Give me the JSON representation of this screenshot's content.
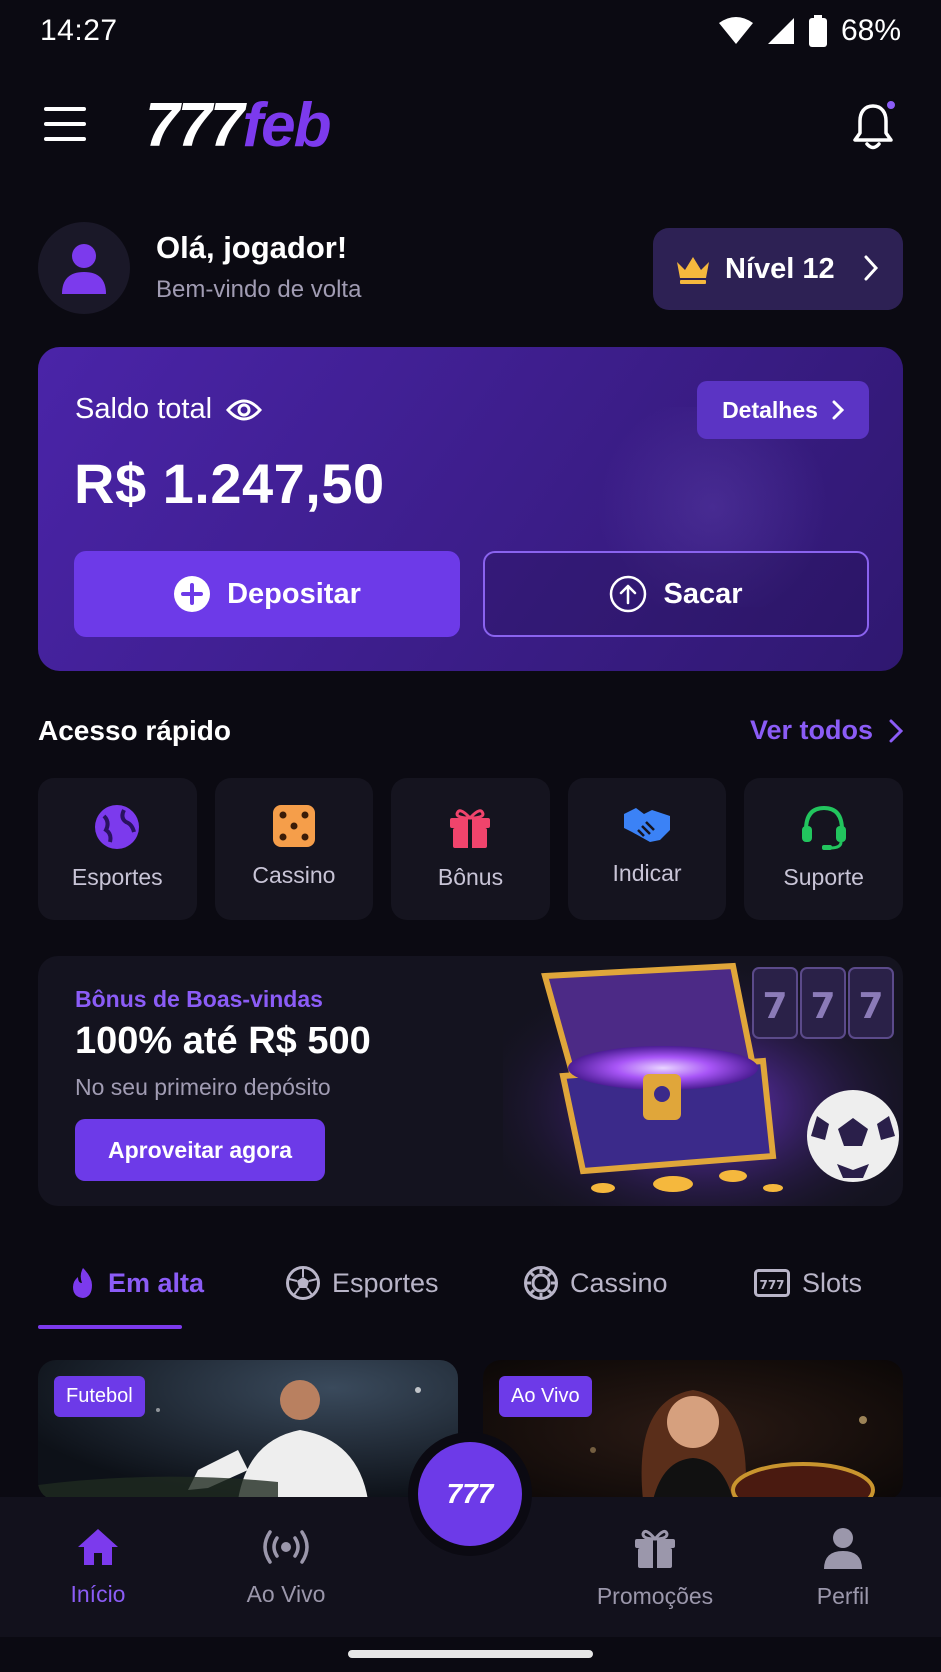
{
  "status_bar": {
    "time": "14:27",
    "battery": "68%"
  },
  "header": {
    "logo_part1": "777",
    "logo_part2": "feb"
  },
  "greeting": {
    "title": "Olá, jogador!",
    "subtitle": "Bem-vindo de volta",
    "level": "Nível 12"
  },
  "balance": {
    "label": "Saldo total",
    "details_label": "Detalhes",
    "value": "R$ 1.247,50",
    "deposit_label": "Depositar",
    "withdraw_label": "Sacar"
  },
  "quick_access": {
    "title": "Acesso rápido",
    "see_all": "Ver todos",
    "items": [
      {
        "label": "Esportes",
        "icon": "globe-icon"
      },
      {
        "label": "Cassino",
        "icon": "dice-icon"
      },
      {
        "label": "Bônus",
        "icon": "gift-icon"
      },
      {
        "label": "Indicar",
        "icon": "handshake-icon"
      },
      {
        "label": "Suporte",
        "icon": "headset-icon"
      }
    ]
  },
  "promo": {
    "kicker": "Bônus de Boas-vindas",
    "title": "100% até R$ 500",
    "subtitle": "No seu primeiro depósito",
    "cta": "Aproveitar agora"
  },
  "tabs": [
    {
      "label": "Em alta",
      "icon": "fire-icon",
      "active": true
    },
    {
      "label": "Esportes",
      "icon": "soccer-ball-icon"
    },
    {
      "label": "Cassino",
      "icon": "casino-chip-icon"
    },
    {
      "label": "Slots",
      "icon": "slot-machine-icon"
    }
  ],
  "cards": [
    {
      "badge": "Futebol"
    },
    {
      "badge": "Ao Vivo"
    }
  ],
  "bottom_nav": {
    "items": [
      {
        "label": "Início",
        "active": true
      },
      {
        "label": "Ao Vivo"
      },
      {
        "label": "Promoções"
      },
      {
        "label": "Perfil"
      }
    ],
    "center_label": "777"
  },
  "colors": {
    "accent": "#7c3aed",
    "background": "#0b0a12",
    "card": "#15141f"
  }
}
